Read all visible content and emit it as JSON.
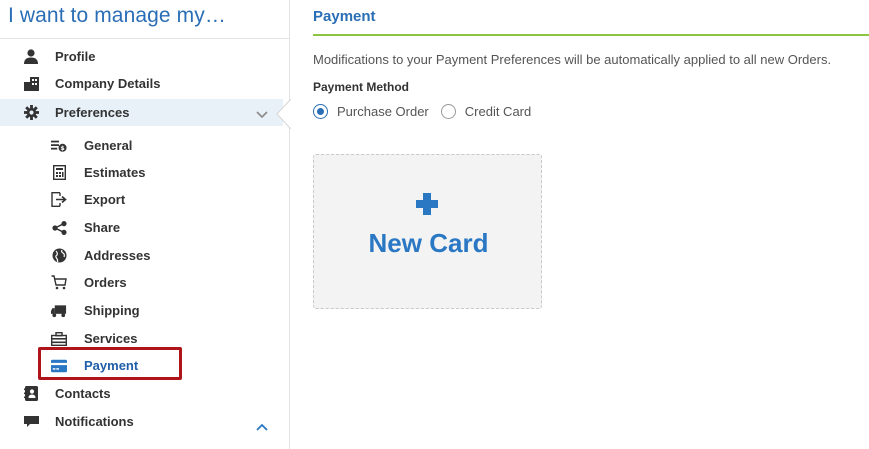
{
  "sidebar": {
    "heading": "I want to manage my…",
    "items": [
      {
        "label": "Profile",
        "icon": "user-icon"
      },
      {
        "label": "Company Details",
        "icon": "building-icon"
      },
      {
        "label": "Preferences",
        "icon": "gear-icon",
        "expanded": true
      },
      {
        "label": "Contacts",
        "icon": "address-book-icon"
      },
      {
        "label": "Notifications",
        "icon": "comment-icon"
      }
    ],
    "preferences_items": [
      {
        "label": "General",
        "icon": "general-settings-icon"
      },
      {
        "label": "Estimates",
        "icon": "calculator-icon"
      },
      {
        "label": "Export",
        "icon": "export-icon"
      },
      {
        "label": "Share",
        "icon": "share-icon"
      },
      {
        "label": "Addresses",
        "icon": "globe-icon"
      },
      {
        "label": "Orders",
        "icon": "cart-icon"
      },
      {
        "label": "Shipping",
        "icon": "truck-icon"
      },
      {
        "label": "Services",
        "icon": "services-icon"
      },
      {
        "label": "Payment",
        "icon": "credit-card-icon",
        "selected": true
      }
    ]
  },
  "main": {
    "title": "Payment",
    "info": "Modifications to your Payment Preferences will be automatically applied to all new Orders.",
    "method_label": "Payment Method",
    "options": [
      {
        "label": "Purchase Order",
        "checked": true
      },
      {
        "label": "Credit Card",
        "checked": false
      }
    ],
    "new_card_label": "New Card"
  },
  "colors": {
    "accent_blue": "#2a6eb5",
    "rule_green": "#8cc63f",
    "highlight_red": "#b0141b",
    "active_bg": "#e8f0f8"
  }
}
